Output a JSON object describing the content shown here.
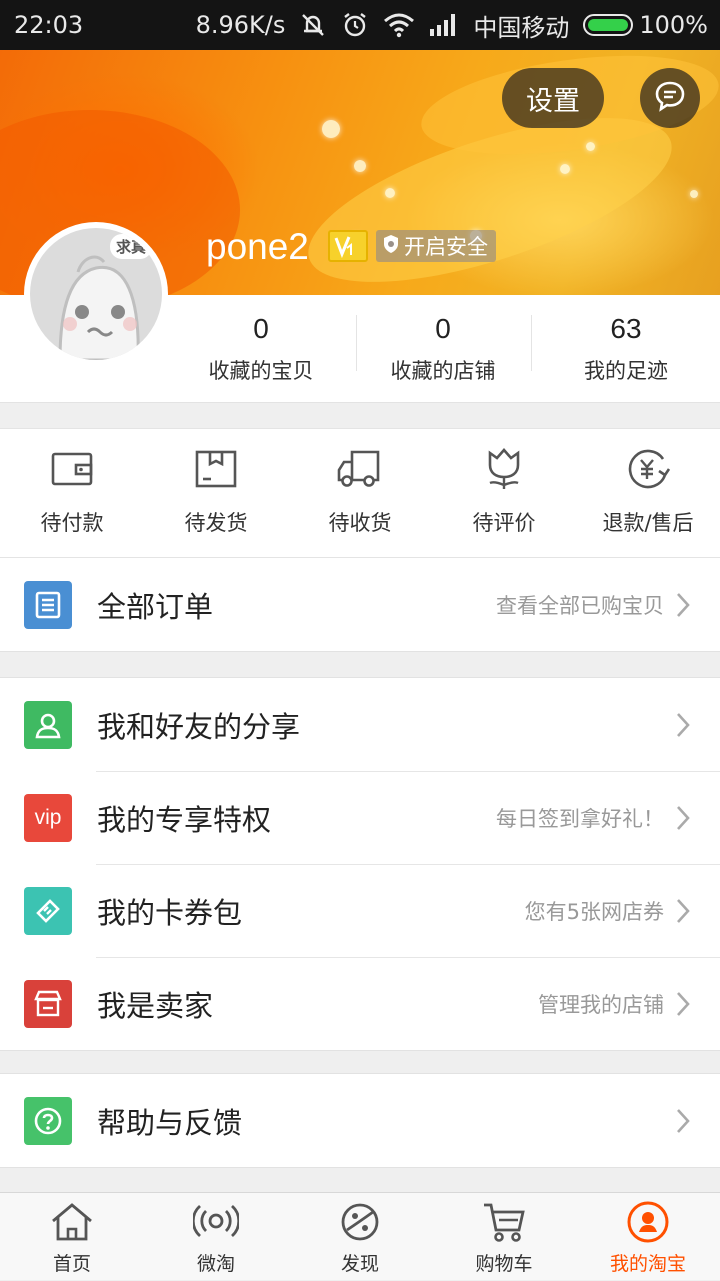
{
  "status_bar": {
    "time": "22:03",
    "speed": "8.96K/s",
    "carrier": "中国移动",
    "battery": "100%"
  },
  "header": {
    "settings_label": "设置",
    "username": "pone2",
    "security_label": "开启安全",
    "avatar_tag": "求真"
  },
  "stats": [
    {
      "value": "0",
      "label": "收藏的宝贝"
    },
    {
      "value": "0",
      "label": "收藏的店铺"
    },
    {
      "value": "63",
      "label": "我的足迹"
    }
  ],
  "orders": [
    {
      "label": "待付款",
      "icon": "wallet-icon"
    },
    {
      "label": "待发货",
      "icon": "package-icon"
    },
    {
      "label": "待收货",
      "icon": "truck-icon"
    },
    {
      "label": "待评价",
      "icon": "flower-icon"
    },
    {
      "label": "退款/售后",
      "icon": "refund-icon"
    }
  ],
  "all_orders": {
    "title": "全部订单",
    "hint": "查看全部已购宝贝",
    "color": "#4a8fd3"
  },
  "menu": [
    {
      "title": "我和好友的分享",
      "hint": "",
      "color": "#3fba62"
    },
    {
      "title": "我的专享特权",
      "hint": "每日签到拿好礼！",
      "color": "#e8483b",
      "badge": "vip"
    },
    {
      "title": "我的卡券包",
      "hint": "您有5张网店券",
      "color": "#3cc3b2"
    },
    {
      "title": "我是卖家",
      "hint": "管理我的店铺",
      "color": "#d9413a"
    }
  ],
  "help": {
    "title": "帮助与反馈",
    "color": "#46c26a"
  },
  "tabs": [
    {
      "label": "首页",
      "icon": "home-icon"
    },
    {
      "label": "微淘",
      "icon": "broadcast-icon"
    },
    {
      "label": "发现",
      "icon": "planet-icon"
    },
    {
      "label": "购物车",
      "icon": "cart-icon"
    },
    {
      "label": "我的淘宝",
      "icon": "profile-icon"
    }
  ],
  "colors": {
    "accent": "#ff5000",
    "header_orange": "#f79010"
  }
}
